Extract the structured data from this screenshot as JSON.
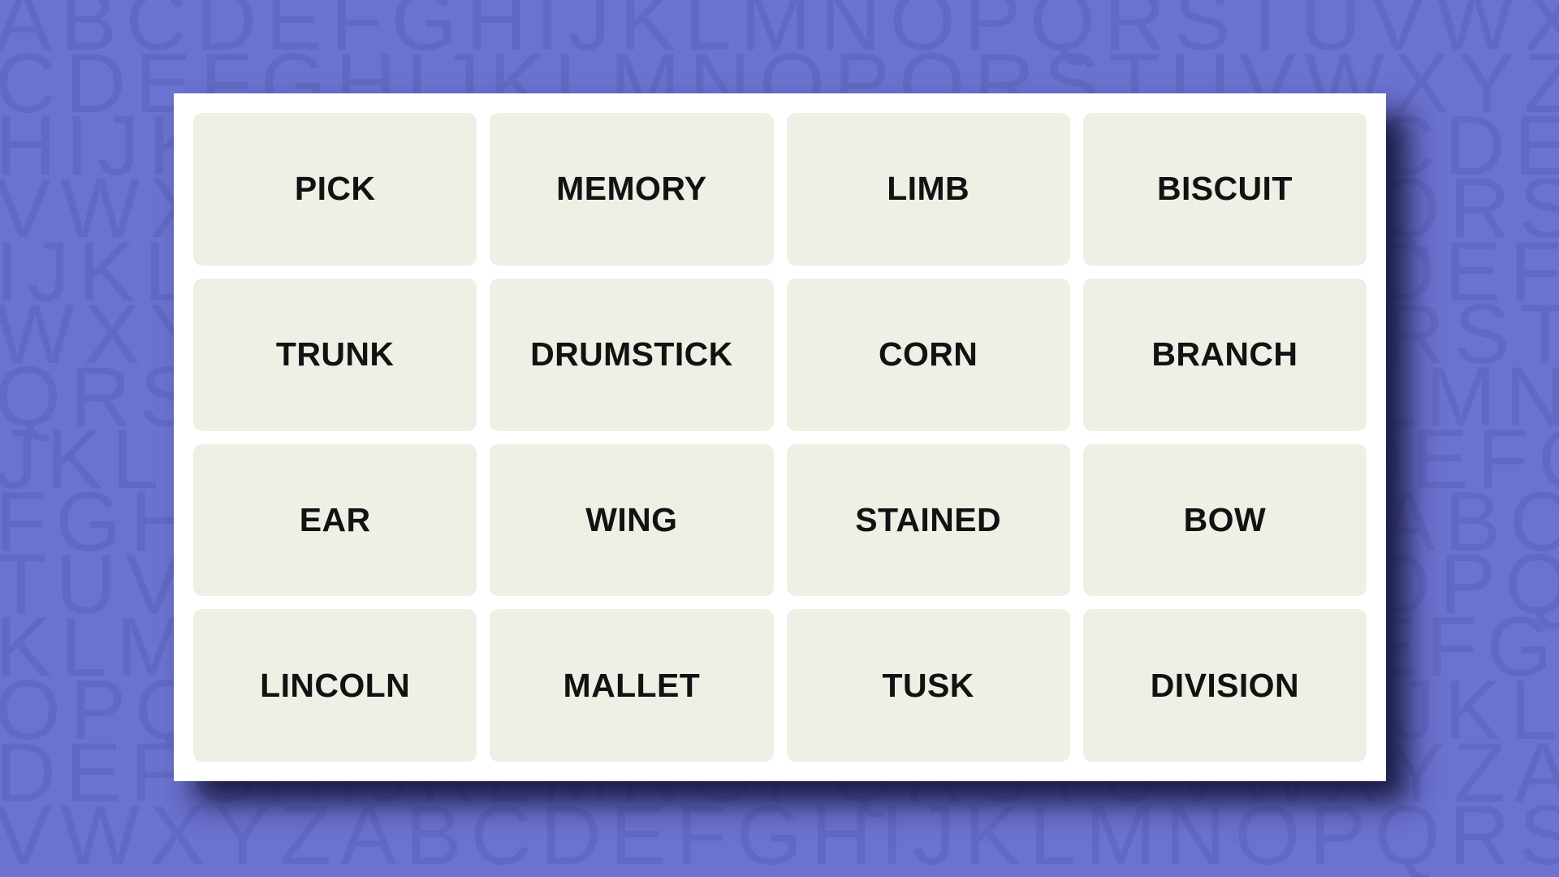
{
  "theme": {
    "background_color": "#6b72cf",
    "background_letter_color": "#6269c4",
    "card_color": "#ffffff",
    "tile_color": "#efefe6",
    "tile_text_color": "#121212",
    "shadow_color": "#141438"
  },
  "background": {
    "pattern_name": "alphabet-tiling",
    "rows": [
      "ABCDEFGHIJKLMNOPQRSTUVWXYZABCDEF",
      "CDEFGHIJKLMNOPQRSTUVWXYZABCDEFGH",
      "HIJKLMNOPQRSTUVWXYZABCDEFGHIJKLM",
      "VWXYZABCDEFGHIJKLMNOPQRSTUVWXYZAB",
      "IJKLMNOPQRSTUVWXYZABCDEFGHIJKLMNO",
      "WXYZABCDEFGHIJKLMNOPQRSTUVWXYZABC",
      "QRSTUVWXYZABCDEFGHIJKLMNOPQRSTUVW",
      "JKLMNOPQRSTUVWXYZABCDEFGHIJKLMNOP",
      "FGHIJKLMNOPQRSTUVWXYZABCDEFGHIJKL",
      "TUVWXYZABCDEFGHIJKLMNOPQRSTUVWXYZ",
      "KLMNOPQRSTUVWXYZABCDEFGHIJKLMNOPQ",
      "OPQRSTUVWXYZABCDEFGHIJKLMNOPQRSTU",
      "DEFGHIJKLMNOPQRSTUVWXYZABCDEFGHIJ",
      "VWXYZABCDEFGHIJKLMNOPQRSTUVWXYZAB"
    ]
  },
  "board": {
    "columns": 4,
    "rows": 4,
    "tiles": [
      [
        {
          "label": "PICK"
        },
        {
          "label": "MEMORY"
        },
        {
          "label": "LIMB"
        },
        {
          "label": "BISCUIT"
        }
      ],
      [
        {
          "label": "TRUNK"
        },
        {
          "label": "DRUMSTICK"
        },
        {
          "label": "CORN"
        },
        {
          "label": "BRANCH"
        }
      ],
      [
        {
          "label": "EAR"
        },
        {
          "label": "WING"
        },
        {
          "label": "STAINED"
        },
        {
          "label": "BOW"
        }
      ],
      [
        {
          "label": "LINCOLN"
        },
        {
          "label": "MALLET"
        },
        {
          "label": "TUSK"
        },
        {
          "label": "DIVISION"
        }
      ]
    ]
  }
}
